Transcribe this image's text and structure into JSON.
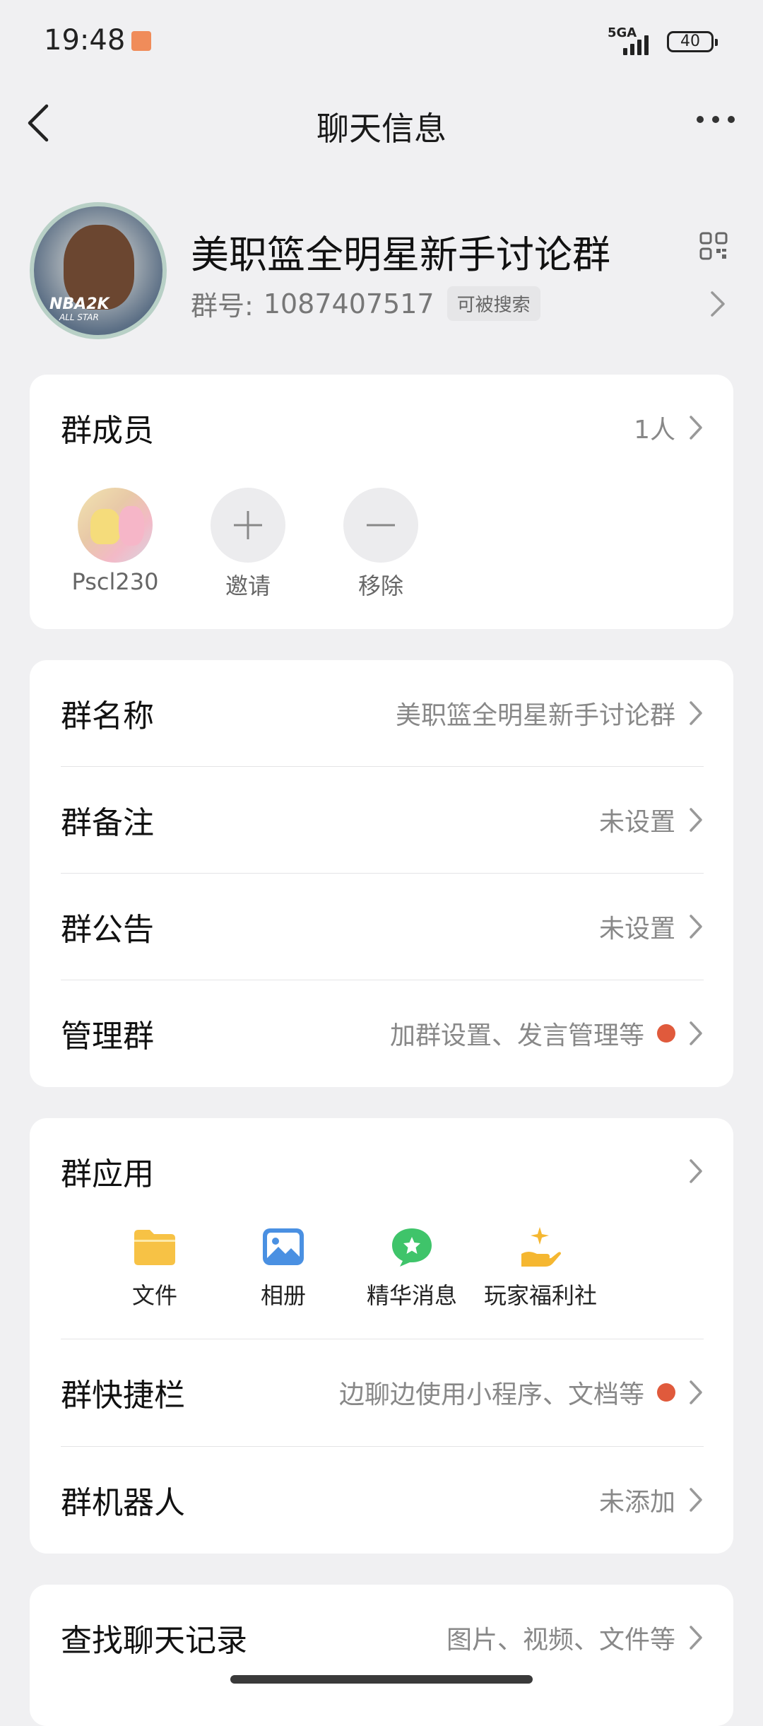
{
  "status_bar": {
    "time": "19:48",
    "network": "5GA",
    "battery": "40"
  },
  "nav": {
    "title": "聊天信息"
  },
  "group": {
    "name": "美职篮全明星新手讨论群",
    "number_label": "群号:",
    "number": "1087407517",
    "search_badge": "可被搜索",
    "avatar_text": "NBA2K",
    "avatar_subtext": "ALL STAR"
  },
  "members_card": {
    "label": "群成员",
    "count": "1人",
    "members": [
      {
        "name": "Pscl230",
        "icon": "user-avatar"
      },
      {
        "name": "邀请",
        "icon": "plus-icon"
      },
      {
        "name": "移除",
        "icon": "minus-icon"
      }
    ]
  },
  "settings_card": {
    "rows": [
      {
        "label": "群名称",
        "value": "美职篮全明星新手讨论群",
        "dot": false
      },
      {
        "label": "群备注",
        "value": "未设置",
        "dot": false
      },
      {
        "label": "群公告",
        "value": "未设置",
        "dot": false
      },
      {
        "label": "管理群",
        "value": "加群设置、发言管理等",
        "dot": true
      }
    ]
  },
  "apps_card": {
    "label": "群应用",
    "apps": [
      {
        "label": "文件",
        "icon": "folder-icon",
        "color": "#f7c245"
      },
      {
        "label": "相册",
        "icon": "album-icon",
        "color": "#4a90e2"
      },
      {
        "label": "精华消息",
        "icon": "star-message-icon",
        "color": "#3fc46a"
      },
      {
        "label": "玩家福利社",
        "icon": "gift-hand-icon",
        "color": "#f5b731"
      }
    ],
    "rows": [
      {
        "label": "群快捷栏",
        "value": "边聊边使用小程序、文档等",
        "dot": true
      },
      {
        "label": "群机器人",
        "value": "未添加",
        "dot": false
      }
    ]
  },
  "history_card": {
    "label": "查找聊天记录",
    "value": "图片、视频、文件等"
  },
  "colors": {
    "background": "#f0f0f2",
    "red_dot": "#e05a3c"
  }
}
